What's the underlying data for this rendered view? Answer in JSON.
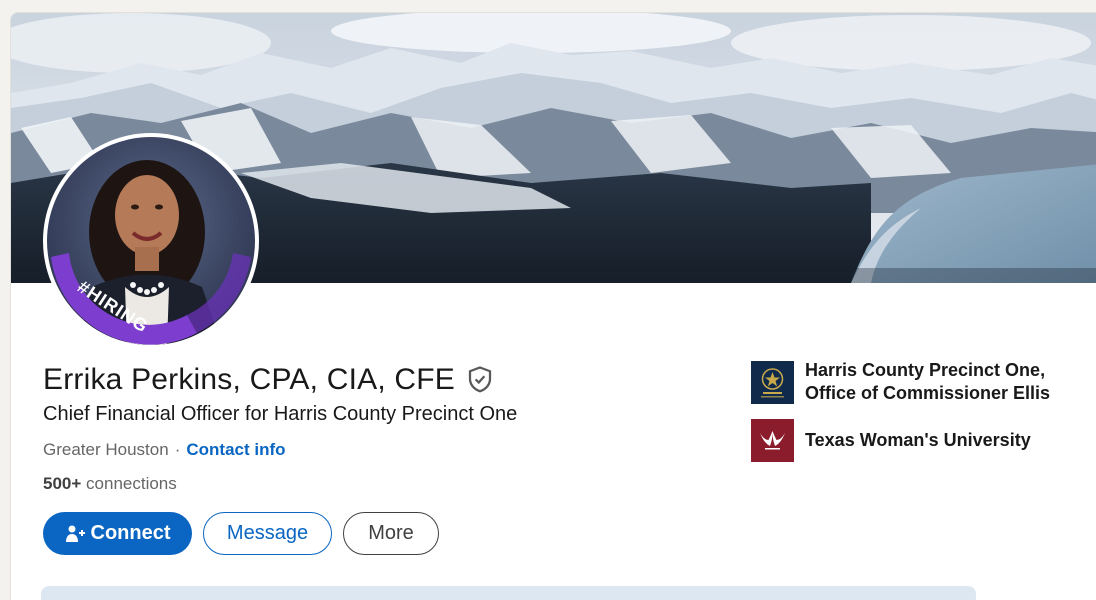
{
  "profile": {
    "name": "Errika Perkins, CPA, CIA, CFE",
    "headline": "Chief Financial Officer for Harris County Precinct One",
    "location": "Greater Houston",
    "separator": "·",
    "contact_info": "Contact info",
    "connections_count": "500+",
    "connections_label": "connections",
    "frame_text": "#HIRING"
  },
  "actions": {
    "connect": "Connect",
    "message": "Message",
    "more": "More"
  },
  "organizations": [
    {
      "name_line1": "Harris County Precinct One,",
      "name_line2": "Office of Commissioner Ellis",
      "logo": "harris-county-logo"
    },
    {
      "name_line1": "Texas Woman's University",
      "name_line2": "",
      "logo": "twu-logo"
    }
  ],
  "colors": {
    "accent": "#0a66c2",
    "hiring_frame": "#7b3fc4",
    "twu_maroon": "#8a1c2b",
    "harris_navy": "#0f2a4a"
  }
}
